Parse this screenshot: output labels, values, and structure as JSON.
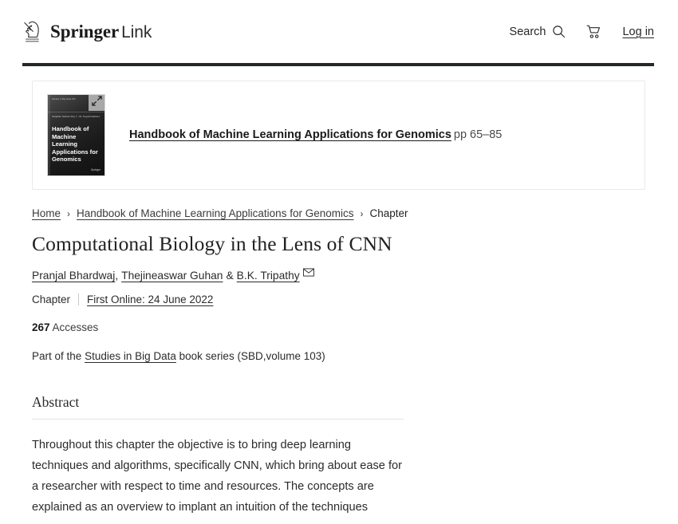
{
  "header": {
    "brand_name_bold": "Springer",
    "brand_name_light": "Link",
    "search_label": "Search",
    "login_label": "Log in",
    "icons": {
      "logo": "springer-knight-logo",
      "search": "search-icon",
      "cart": "shopping-cart-icon"
    }
  },
  "book_card": {
    "cover": {
      "series_line": "Studies in Big Data  103",
      "editors_line": "Sanjiban Sekhar Roy\nY. -W. Tuguchi  Editors",
      "title": "Handbook of Machine Learning Applications for Genomics",
      "publisher": "Springer",
      "expand_icon": "expand-diagonal-icon"
    },
    "book_title": "Handbook of Machine Learning Applications for Genomics",
    "pages": "pp 65–85"
  },
  "breadcrumb": {
    "items": [
      {
        "label": "Home",
        "link": true
      },
      {
        "label": "Handbook of Machine Learning Applications for Genomics",
        "link": true
      },
      {
        "label": "Chapter",
        "link": false
      }
    ],
    "separator": "›"
  },
  "chapter": {
    "title": "Computational Biology in the Lens of CNN",
    "authors": [
      "Pranjal Bhardwaj",
      "Thejineaswar Guhan",
      "B.K. Tripathy"
    ],
    "author_conjunction": "&",
    "corresponding_author_icon": "envelope-icon",
    "type_label": "Chapter",
    "first_online_label": "First Online: 24 June 2022",
    "accesses_count": "267",
    "accesses_label": "Accesses",
    "series_prefix": "Part of the",
    "series_name": "Studies in Big Data",
    "series_suffix": "book series (SBD,volume 103)"
  },
  "abstract": {
    "heading": "Abstract",
    "text": "Throughout this chapter the objective is to bring deep learning techniques and algorithms, specifically CNN, which bring about ease for a researcher with respect to time and resources. The concepts are explained as an overview to implant an intuition of the techniques"
  },
  "colors": {
    "header_rule": "#25282a",
    "card_border": "#e9e9e9",
    "text_primary": "#222222",
    "divider": "#e3e3e3"
  }
}
